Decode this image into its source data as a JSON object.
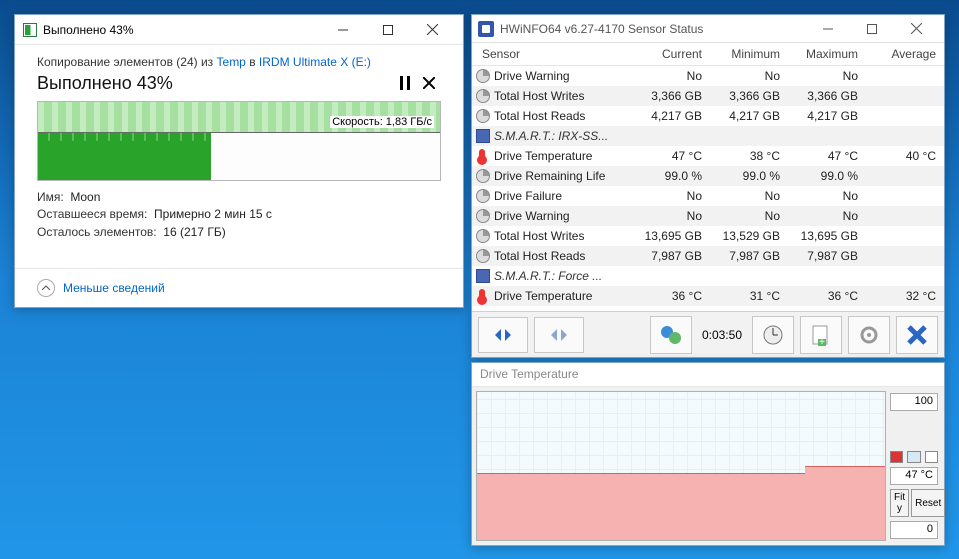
{
  "copy": {
    "title": "Выполнено 43%",
    "from_prefix": "Копирование элементов (24) из ",
    "from_src": "Temp",
    "from_in": " в ",
    "from_dst": "IRDM Ultimate X (E:)",
    "main": "Выполнено 43%",
    "speed_label": "Скорость: 1,83 ГБ/с",
    "name_label": "Имя:",
    "name_value": "Moon",
    "time_label": "Оставшееся время:",
    "time_value": "Примерно 2 мин 15 с",
    "remain_label": "Осталось элементов:",
    "remain_value": "16 (217 ГБ)",
    "less_details": "Меньше сведений"
  },
  "hwinfo": {
    "title": "HWiNFO64 v6.27-4170 Sensor Status",
    "cols": {
      "sensor": "Sensor",
      "current": "Current",
      "min": "Minimum",
      "max": "Maximum",
      "avg": "Average"
    },
    "rows": [
      {
        "type": "row",
        "icon": "clock",
        "name": "Drive Warning",
        "cur": "No",
        "min": "No",
        "max": "No",
        "avg": ""
      },
      {
        "type": "row",
        "icon": "clock",
        "name": "Total Host Writes",
        "cur": "3,366 GB",
        "min": "3,366 GB",
        "max": "3,366 GB",
        "avg": ""
      },
      {
        "type": "row",
        "icon": "clock",
        "name": "Total Host Reads",
        "cur": "4,217 GB",
        "min": "4,217 GB",
        "max": "4,217 GB",
        "avg": ""
      },
      {
        "type": "section",
        "icon": "chip",
        "name": "S.M.A.R.T.: IRX-SS..."
      },
      {
        "type": "row",
        "icon": "therm",
        "name": "Drive Temperature",
        "cur": "47 °C",
        "min": "38 °C",
        "max": "47 °C",
        "avg": "40 °C"
      },
      {
        "type": "row",
        "icon": "clock",
        "name": "Drive Remaining Life",
        "cur": "99.0 %",
        "min": "99.0 %",
        "max": "99.0 %",
        "avg": ""
      },
      {
        "type": "row",
        "icon": "clock",
        "name": "Drive Failure",
        "cur": "No",
        "min": "No",
        "max": "No",
        "avg": ""
      },
      {
        "type": "row",
        "icon": "clock",
        "name": "Drive Warning",
        "cur": "No",
        "min": "No",
        "max": "No",
        "avg": ""
      },
      {
        "type": "row",
        "icon": "clock",
        "name": "Total Host Writes",
        "cur": "13,695 GB",
        "min": "13,529 GB",
        "max": "13,695 GB",
        "avg": ""
      },
      {
        "type": "row",
        "icon": "clock",
        "name": "Total Host Reads",
        "cur": "7,987 GB",
        "min": "7,987 GB",
        "max": "7,987 GB",
        "avg": ""
      },
      {
        "type": "section",
        "icon": "chip",
        "name": "S.M.A.R.T.: Force ..."
      },
      {
        "type": "row",
        "icon": "therm",
        "name": "Drive Temperature",
        "cur": "36 °C",
        "min": "31 °C",
        "max": "36 °C",
        "avg": "32 °C"
      }
    ],
    "elapsed": "0:03:50"
  },
  "graph": {
    "title": "Drive Temperature",
    "ymax": "100",
    "current": "47 °C",
    "ymin": "0",
    "fit": "Fit y",
    "reset": "Reset"
  },
  "chart_data": {
    "type": "area",
    "title": "Drive Temperature",
    "ylabel": "°C",
    "ylim": [
      0,
      100
    ],
    "series": [
      {
        "name": "Drive Temperature",
        "color": "#d33",
        "values": [
          40,
          40,
          40,
          40,
          40,
          40,
          40,
          40,
          40,
          40,
          40,
          40,
          40,
          40,
          40,
          40,
          40,
          40,
          40,
          40,
          40,
          40,
          40,
          40,
          40,
          40,
          40,
          40,
          41,
          42,
          43,
          44,
          45,
          46,
          47,
          47
        ]
      }
    ]
  }
}
